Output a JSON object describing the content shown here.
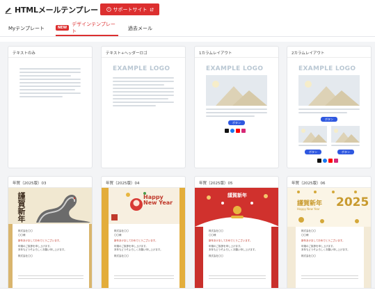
{
  "header": {
    "app_title": "HTMLメールテンプレート",
    "support_label": "サポートサイト"
  },
  "tabs": {
    "my_templates": "Myテンプレート",
    "new_badge": "NEW",
    "design_templates": "デザインテンプレート",
    "past_mail": "過去メール"
  },
  "templates": [
    {
      "title": "テキストのみ"
    },
    {
      "title": "テキスト+ヘッダーロゴ",
      "logo": "EXAMPLE LOGO"
    },
    {
      "title": "1カラムレイアウト",
      "logo": "EXAMPLE LOGO",
      "button": "ボタン"
    },
    {
      "title": "2カラムレイアウト",
      "logo": "EXAMPLE LOGO",
      "button": "ボタン"
    },
    {
      "title": "年賀（2025版）03",
      "title_art": "謹賀新年"
    },
    {
      "title": "年賀（2025版）04",
      "title_art": "Happy New Year"
    },
    {
      "title": "年賀（2025版）05",
      "title_art": "謹賀新年"
    },
    {
      "title": "年賀（2025版）06",
      "title_art": "謹賀新年",
      "year": "2025",
      "subtitle": "Happy New Year"
    }
  ],
  "letter": {
    "company": "株式会社〇〇",
    "name": "〇〇様",
    "greeting": "新年あけましておめでとうございます。",
    "body1": "年頭のご挨拶を申し上げます。",
    "body2": "本年もどうぞよろしくお願い申し上げます。",
    "sender": "株式会社〇〇"
  },
  "colors": {
    "accent_red": "#dc2f2f",
    "button_blue": "#2f58e0"
  }
}
